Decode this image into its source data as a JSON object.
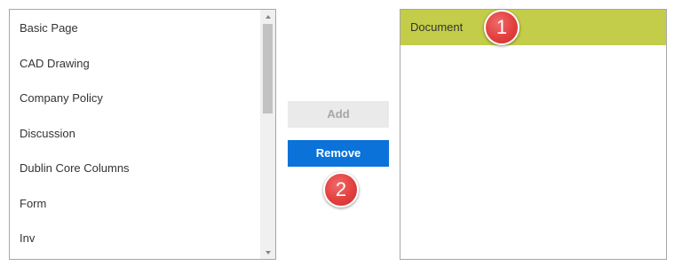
{
  "available_list": {
    "items": [
      "Basic Page",
      "CAD Drawing",
      "Company Policy",
      "Discussion",
      "Dublin Core Columns",
      "Form",
      "Inv"
    ]
  },
  "buttons": {
    "add_label": "Add",
    "remove_label": "Remove"
  },
  "selected_list": {
    "items": [
      "Document"
    ],
    "selected_index": 0
  },
  "callouts": {
    "first": "1",
    "second": "2"
  },
  "colors": {
    "selected_row": "#c3cd49",
    "remove_button": "#0a72d8",
    "add_button_disabled": "#eaeaea",
    "badge": "#e2403f"
  },
  "icons": {
    "scroll_up": "scroll-up-arrow-icon",
    "scroll_down": "scroll-down-arrow-icon"
  }
}
